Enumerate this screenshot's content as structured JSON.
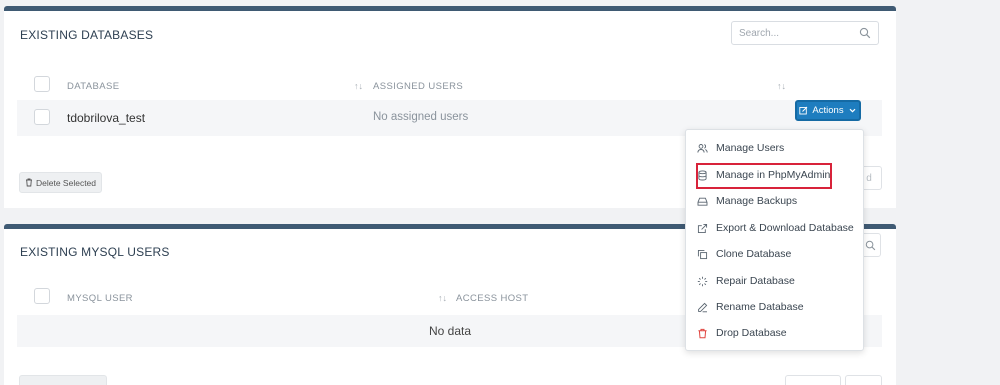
{
  "databases_panel": {
    "title": "EXISTING DATABASES",
    "search_placeholder": "Search...",
    "columns": {
      "database": "DATABASE",
      "assigned_users": "ASSIGNED USERS"
    },
    "rows": [
      {
        "database": "tdobrilova_test",
        "assigned_users": "No assigned users",
        "actions_label": "Actions"
      }
    ],
    "delete_selected_label": "Delete Selected",
    "partial_button_fragment": "d"
  },
  "actions_menu": {
    "items": [
      {
        "label": "Manage Users",
        "icon": "users-icon"
      },
      {
        "label": "Manage in PhpMyAdmin",
        "icon": "database-icon",
        "highlighted": true
      },
      {
        "label": "Manage Backups",
        "icon": "hard-drive-icon"
      },
      {
        "label": "Export & Download Database",
        "icon": "external-link-icon"
      },
      {
        "label": "Clone Database",
        "icon": "copy-icon"
      },
      {
        "label": "Repair Database",
        "icon": "loader-icon"
      },
      {
        "label": "Rename Database",
        "icon": "pencil-icon"
      },
      {
        "label": "Drop Database",
        "icon": "trash-icon",
        "color": "#e0443f"
      }
    ],
    "highlight_color": "#d8233a"
  },
  "mysql_users_panel": {
    "title": "EXISTING MYSQL USERS",
    "columns": {
      "mysql_user": "MYSQL USER",
      "access_host": "ACCESS HOST"
    },
    "empty_text": "No data"
  },
  "colors": {
    "panel_header_bar": "#3f5a73",
    "primary_button": "#1e7dbf",
    "background": "#f1f2f4"
  }
}
